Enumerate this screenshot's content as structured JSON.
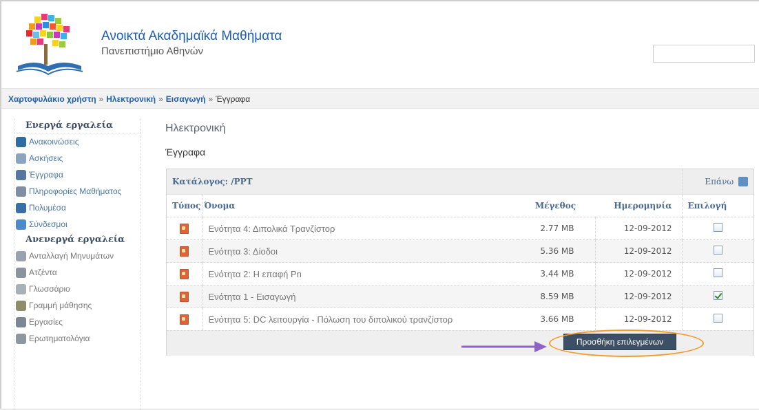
{
  "header": {
    "site_title": "Ανοικτά Ακαδημαϊκά Μαθήματα",
    "site_subtitle": "Πανεπιστήμιο Αθηνών",
    "search_value": ""
  },
  "breadcrumb": [
    {
      "label": "Χαρτοφυλάκιο χρήστη",
      "link": true
    },
    {
      "label": "Ηλεκτρονική",
      "link": true
    },
    {
      "label": "Εισαγωγή",
      "link": true
    },
    {
      "label": "Έγγραφα",
      "link": false
    }
  ],
  "breadcrumb_sep": "»",
  "sidebar": {
    "active_heading": "Ενεργά εργαλεία",
    "active_items": [
      {
        "label": "Ανακοινώσεις",
        "icon": "announcements-icon",
        "color": "#2e6da4"
      },
      {
        "label": "Ασκήσεις",
        "icon": "exercises-icon",
        "color": "#8aa4c2"
      },
      {
        "label": "Έγγραφα",
        "icon": "documents-icon",
        "color": "#5577a0"
      },
      {
        "label": "Πληροφορίες Μαθήματος",
        "icon": "course-info-icon",
        "color": "#7f8ea3"
      },
      {
        "label": "Πολυμέσα",
        "icon": "multimedia-icon",
        "color": "#3a6ea8"
      },
      {
        "label": "Σύνδεσμοι",
        "icon": "links-icon",
        "color": "#4c8bc9"
      }
    ],
    "inactive_heading": "Ανενεργά εργαλεία",
    "inactive_items": [
      {
        "label": "Ανταλλαγή Μηνυμάτων",
        "icon": "messages-icon",
        "color": "#9aa3ad"
      },
      {
        "label": "Ατζέντα",
        "icon": "agenda-icon",
        "color": "#8b949e"
      },
      {
        "label": "Γλωσσάριο",
        "icon": "glossary-icon",
        "color": "#a8b0b8"
      },
      {
        "label": "Γραμμή μάθησης",
        "icon": "learning-path-icon",
        "color": "#8d8d6a"
      },
      {
        "label": "Εργασίες",
        "icon": "assignments-icon",
        "color": "#7d8794"
      },
      {
        "label": "Ερωτηματολόγια",
        "icon": "questionnaires-icon",
        "color": "#8e969f"
      }
    ]
  },
  "main": {
    "course_title": "Ηλεκτρονική",
    "section_title": "Έγγραφα",
    "directory_label": "Κατάλογος: /PPT",
    "up_label": "Επάνω",
    "columns": {
      "type": "Τύπος",
      "name": "Όνομα",
      "size": "Μέγεθος",
      "date": "Ημερομηνία",
      "select": "Επιλογή"
    },
    "files": [
      {
        "name": "Ενότητα 4: Διπολικά Τρανζίστορ",
        "size": "2.77 MB",
        "date": "12-09-2012",
        "checked": false
      },
      {
        "name": "Ενότητα 3: Δίοδοι",
        "size": "5.36 MB",
        "date": "12-09-2012",
        "checked": false
      },
      {
        "name": "Ενότητα 2: Η επαφή Pn",
        "size": "3.44 MB",
        "date": "12-09-2012",
        "checked": false
      },
      {
        "name": "Ενότητα 1 - Εισαγωγή",
        "size": "8.59 MB",
        "date": "12-09-2012",
        "checked": true
      },
      {
        "name": "Ενότητα 5: DC λειτουργία - Πόλωση του διπολικού τρανζίστορ",
        "size": "3.66 MB",
        "date": "12-09-2012",
        "checked": false
      }
    ],
    "add_selected_label": "Προσθήκη επιλεγμένων"
  },
  "colors": {
    "link": "#1f5fad",
    "button": "#3d4f64",
    "highlight_ellipse": "#f29b26",
    "arrow": "#8e63c6"
  }
}
